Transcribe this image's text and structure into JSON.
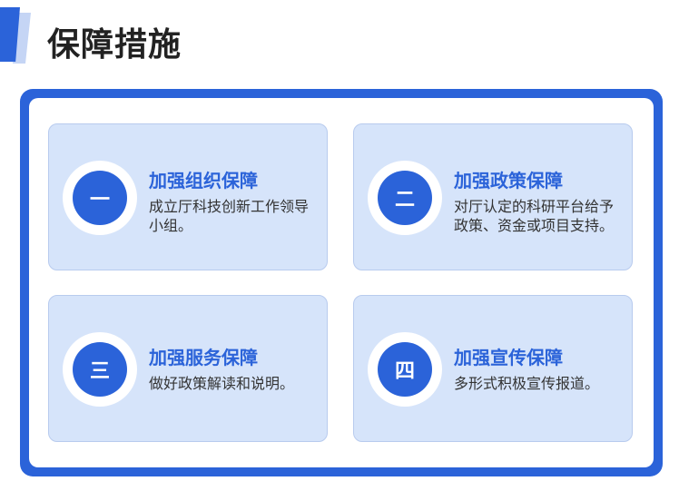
{
  "section": {
    "title": "保障措施"
  },
  "cards": [
    {
      "number": "一",
      "title": "加强组织保障",
      "description": "成立厅科技创新工作领导小组。"
    },
    {
      "number": "二",
      "title": "加强政策保障",
      "description": "对厅认定的科研平台给予政策、资金或项目支持。"
    },
    {
      "number": "三",
      "title": "加强服务保障",
      "description": "做好政策解读和说明。"
    },
    {
      "number": "四",
      "title": "加强宣传保障",
      "description": "多形式积极宣传报道。"
    }
  ],
  "colors": {
    "accent": "#2b63d9",
    "card_bg": "#d6e4fa",
    "title_text": "#222222"
  }
}
